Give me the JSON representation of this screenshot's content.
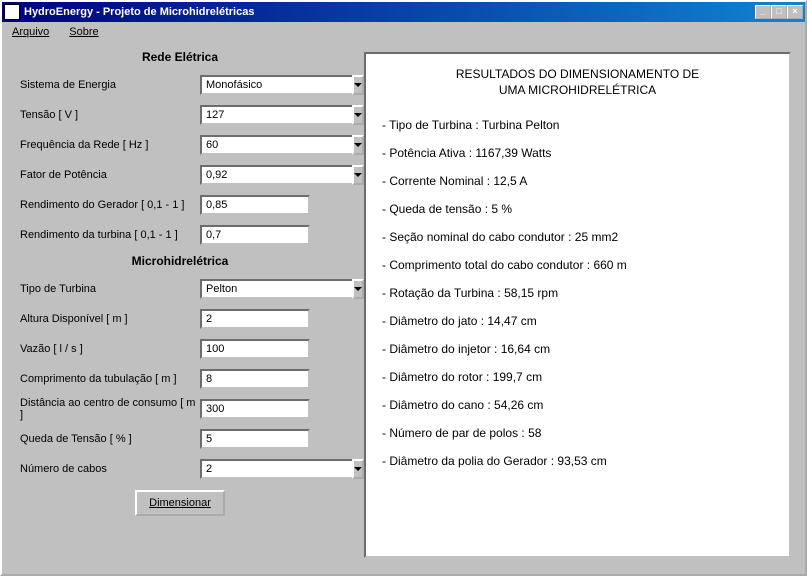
{
  "window": {
    "title": "HydroEnergy - Projeto de Microhidrelétricas",
    "menu": {
      "arquivo": "Arquivo",
      "sobre": "Sobre"
    }
  },
  "sections": {
    "rede": "Rede Elétrica",
    "micro": "Microhidrelétrica"
  },
  "rede": {
    "sistema_label": "Sistema de Energia",
    "sistema_value": "Monofásico",
    "tensao_label": "Tensão [ V ]",
    "tensao_value": "127",
    "freq_label": "Frequência da Rede [ Hz ]",
    "freq_value": "60",
    "fator_label": "Fator de Potência",
    "fator_value": "0,92",
    "rend_ger_label": "Rendimento do Gerador [ 0,1 - 1 ]",
    "rend_ger_value": "0,85",
    "rend_turb_label": "Rendimento da turbina [ 0,1 - 1 ]",
    "rend_turb_value": "0,7"
  },
  "micro": {
    "tipo_label": "Tipo de Turbina",
    "tipo_value": "Pelton",
    "altura_label": "Altura Disponível [ m ]",
    "altura_value": "2",
    "vazao_label": "Vazão [ l / s ]",
    "vazao_value": "100",
    "comp_tub_label": "Comprimento da tubulação [ m ]",
    "comp_tub_value": "8",
    "dist_label": "Distância ao centro de consumo [ m ]",
    "dist_value": "300",
    "queda_label": "Queda de Tensão [ % ]",
    "queda_value": "5",
    "num_cabos_label": "Número de cabos",
    "num_cabos_value": "2"
  },
  "button": {
    "dimensionar": "Dimensionar"
  },
  "results": {
    "title_line1": "RESULTADOS DO DIMENSIONAMENTO DE",
    "title_line2": "UMA MICROHIDRELÉTRICA",
    "lines": [
      "- Tipo de Turbina : Turbina Pelton",
      "- Potência Ativa : 1167,39 Watts",
      "- Corrente Nominal : 12,5 A",
      "- Queda de tensão : 5 %",
      "- Seção nominal do cabo condutor : 25 mm2",
      "- Comprimento total do cabo condutor : 660 m",
      "- Rotação da Turbina : 58,15 rpm",
      "- Diâmetro do jato : 14,47 cm",
      "- Diâmetro do injetor : 16,64 cm",
      "- Diâmetro do rotor : 199,7 cm",
      "- Diâmetro do cano : 54,26 cm",
      "- Número de par de polos : 58",
      "- Diâmetro da polia do Gerador : 93,53 cm"
    ]
  }
}
